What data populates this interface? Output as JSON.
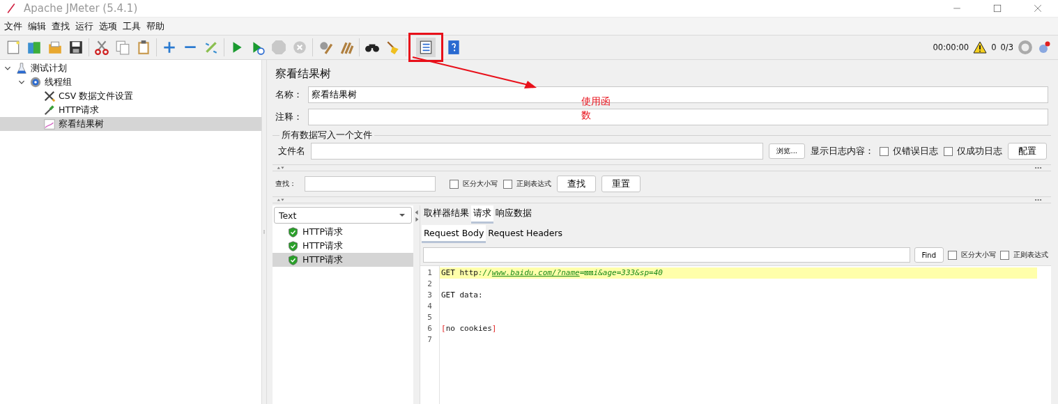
{
  "window": {
    "title": "Apache JMeter (5.4.1)"
  },
  "menu": [
    "文件",
    "编辑",
    "查找",
    "运行",
    "选项",
    "工具",
    "帮助"
  ],
  "status": {
    "elapsed": "00:00:00",
    "warnings": "0",
    "threads": "0/3"
  },
  "tree": [
    {
      "label": "测试计划",
      "kind": "plan",
      "expanded": true,
      "selected": false,
      "children": [
        {
          "label": "线程组",
          "kind": "thread-group",
          "expanded": true,
          "selected": false,
          "children": [
            {
              "label": "CSV 数据文件设置",
              "kind": "config",
              "selected": false
            },
            {
              "label": "HTTP请求",
              "kind": "sampler",
              "selected": false
            },
            {
              "label": "察看结果树",
              "kind": "listener",
              "selected": true
            }
          ]
        }
      ]
    }
  ],
  "panel": {
    "title": "察看结果树",
    "name_label": "名称：",
    "name_value": "察看结果树",
    "comment_label": "注释：",
    "file_group": {
      "legend": "所有数据写入一个文件",
      "filename_label": "文件名",
      "browse_button": "浏览...",
      "log_label": "显示日志内容：",
      "checkboxes": [
        {
          "label": "仅错误日志",
          "checked": false
        },
        {
          "label": "仅成功日志",
          "checked": false
        }
      ],
      "config_button": "配置"
    },
    "search": {
      "label": "查找：",
      "checkboxes": [
        {
          "label": "区分大小写",
          "checked": false
        },
        {
          "label": "正则表达式",
          "checked": false
        }
      ],
      "buttons": [
        "查找",
        "重置"
      ]
    },
    "results": {
      "renderer": "Text",
      "items": [
        {
          "label": "HTTP请求",
          "selected": false
        },
        {
          "label": "HTTP请求",
          "selected": false
        },
        {
          "label": "HTTP请求",
          "selected": true
        }
      ]
    },
    "tabs": [
      {
        "label": "取样器结果",
        "selected": false
      },
      {
        "label": "请求",
        "selected": true
      },
      {
        "label": "响应数据",
        "selected": false
      }
    ],
    "subtabs": [
      {
        "label": "Request Body",
        "selected": true
      },
      {
        "label": "Request Headers",
        "selected": false
      }
    ],
    "find": {
      "button": "Find",
      "checkboxes": [
        {
          "label": "区分大小写",
          "checked": false
        },
        {
          "label": "正则表达式",
          "checked": false
        }
      ]
    },
    "code_lines": [
      {
        "number": "1",
        "highlighted": true,
        "segments": [
          {
            "kind": "plain",
            "text": "GET http"
          },
          {
            "kind": "punct",
            "text": "://"
          },
          {
            "kind": "link",
            "text": "www.baidu.com/?name"
          },
          {
            "kind": "punct",
            "text": "="
          },
          {
            "kind": "param",
            "text": "⊠⊠i&age=333&sp=40"
          }
        ]
      },
      {
        "number": "2",
        "highlighted": false
      },
      {
        "number": "3",
        "highlighted": false,
        "segments": [
          {
            "kind": "plain",
            "text": "GET data:"
          }
        ]
      },
      {
        "number": "4",
        "highlighted": false
      },
      {
        "number": "5",
        "highlighted": false
      },
      {
        "number": "6",
        "highlighted": false,
        "segments": [
          {
            "kind": "bracket",
            "text": "["
          },
          {
            "kind": "plain",
            "text": "no cookies"
          },
          {
            "kind": "bracket",
            "text": "]"
          }
        ]
      },
      {
        "number": "7",
        "highlighted": false
      }
    ]
  },
  "annotation": {
    "text": "使用函数"
  }
}
